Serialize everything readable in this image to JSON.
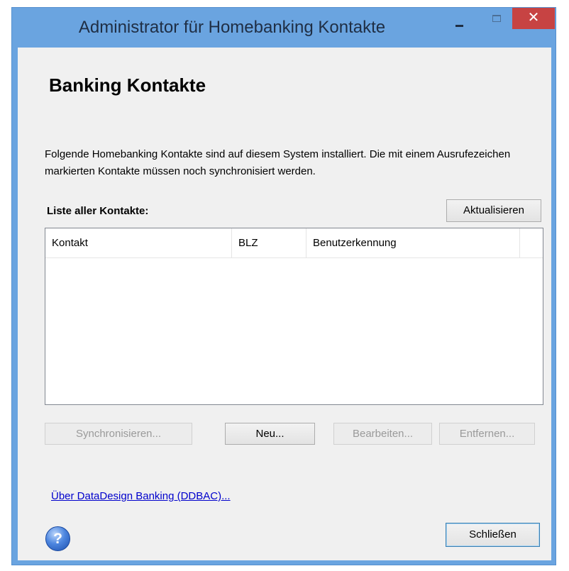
{
  "window": {
    "title": "Administrator für Homebanking Kontakte",
    "close_glyph": "✕"
  },
  "main": {
    "heading": "Banking Kontakte",
    "description": "Folgende Homebanking Kontakte sind auf diesem System installiert. Die mit einem Ausrufezeichen markierten Kontakte müssen noch synchronisiert werden.",
    "list_label": "Liste aller Kontakte:",
    "refresh_label": "Aktualisieren",
    "columns": [
      "Kontakt",
      "BLZ",
      "Benutzerkennung"
    ],
    "rows": []
  },
  "actions": {
    "sync_label": "Synchronisieren...",
    "new_label": "Neu...",
    "edit_label": "Bearbeiten...",
    "remove_label": "Entfernen..."
  },
  "footer": {
    "about_link": "Über DataDesign Banking (DDBAC)...",
    "help_glyph": "?",
    "close_label": "Schließen"
  },
  "icons": {
    "help": "help-icon",
    "minimize": "minimize-icon",
    "maximize": "maximize-icon",
    "close": "close-icon"
  },
  "colors": {
    "titlebar": "#6aa4e0",
    "close_button": "#c74343",
    "client_background": "#f0f0f0",
    "link": "#0000cc"
  }
}
